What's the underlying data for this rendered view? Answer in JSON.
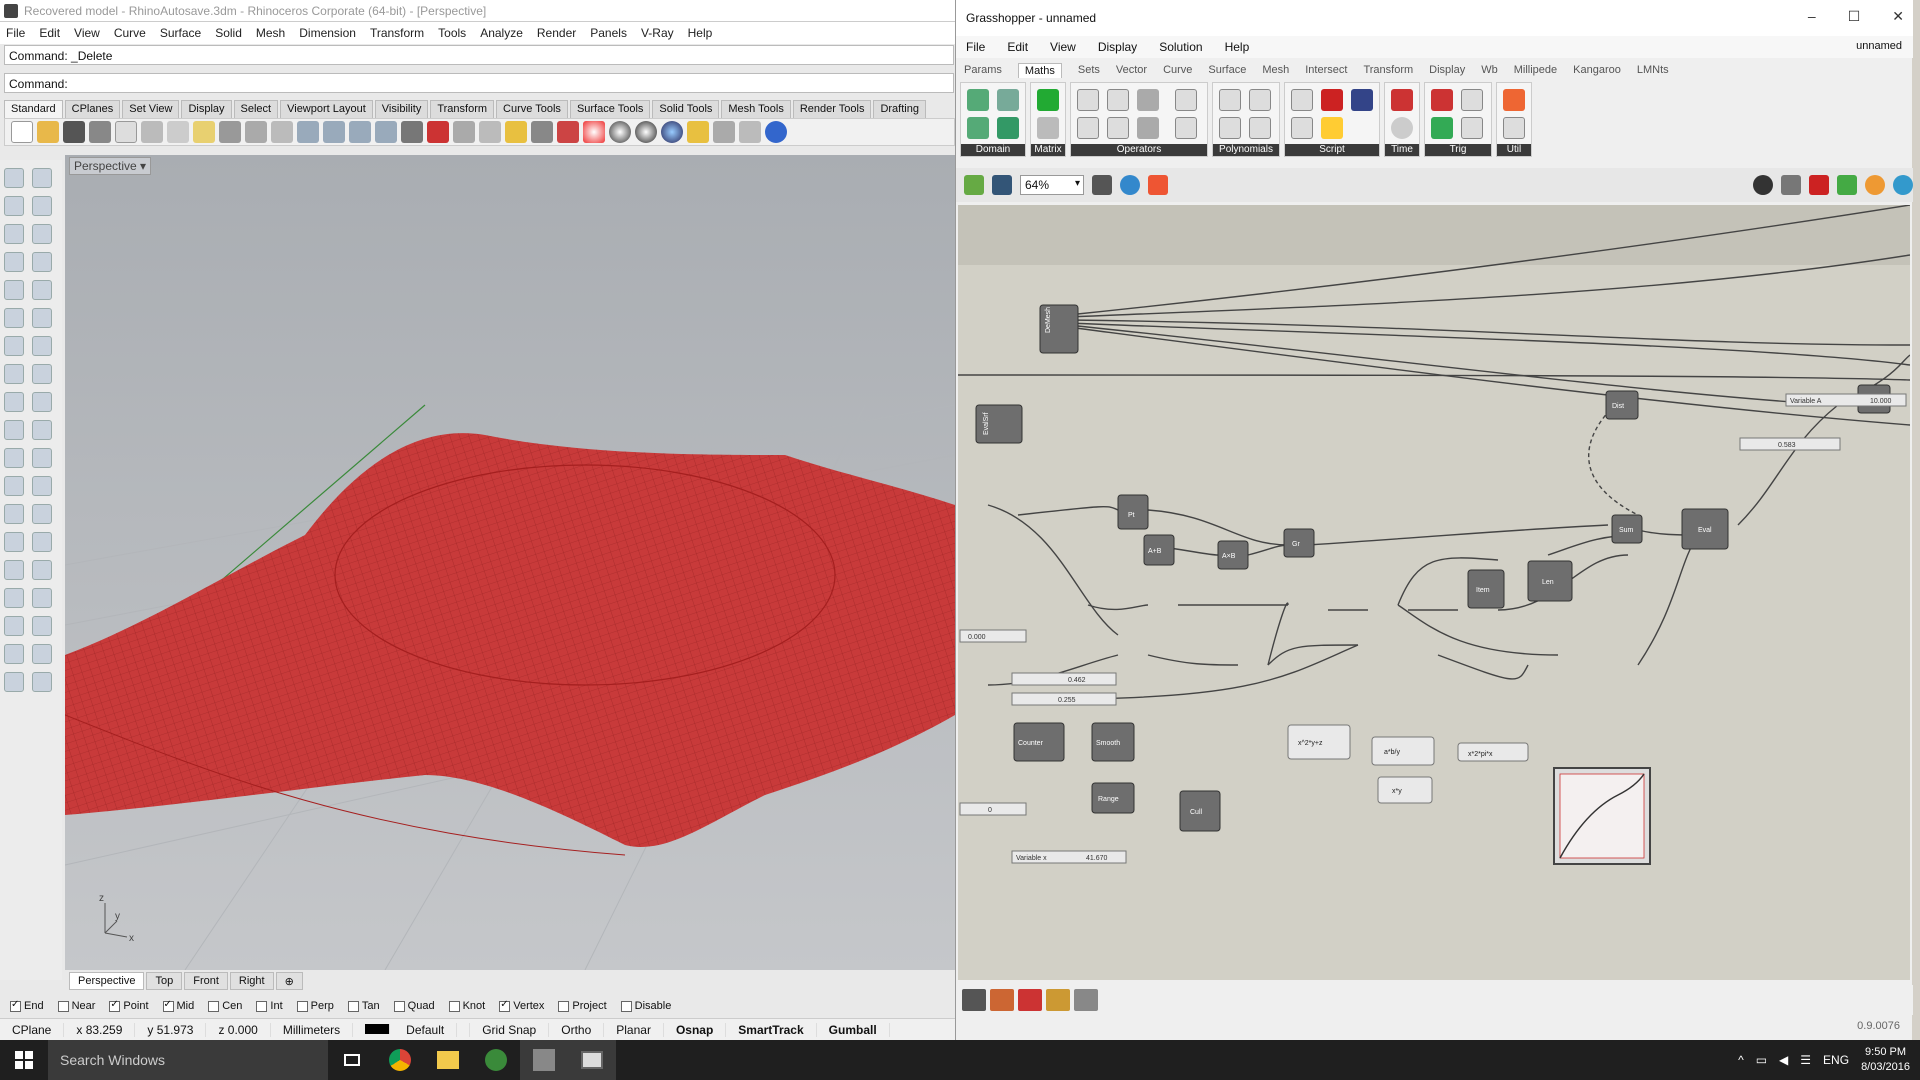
{
  "rhino": {
    "title": "Recovered model - RhinoAutosave.3dm - Rhinoceros Corporate (64-bit) - [Perspective]",
    "menu": [
      "File",
      "Edit",
      "View",
      "Curve",
      "Surface",
      "Solid",
      "Mesh",
      "Dimension",
      "Transform",
      "Tools",
      "Analyze",
      "Render",
      "Panels",
      "V-Ray",
      "Help"
    ],
    "command_history": "Command: _Delete",
    "command_prompt": "Command:",
    "toolbar_tabs": [
      "Standard",
      "CPlanes",
      "Set View",
      "Display",
      "Select",
      "Viewport Layout",
      "Visibility",
      "Transform",
      "Curve Tools",
      "Surface Tools",
      "Solid Tools",
      "Mesh Tools",
      "Render Tools",
      "Drafting"
    ],
    "viewport_label": "Perspective",
    "viewport_tabs": [
      "Perspective",
      "Top",
      "Front",
      "Right"
    ],
    "axis": {
      "z": "z",
      "y": "y",
      "x": "x"
    },
    "osnaps": [
      {
        "label": "End",
        "checked": true
      },
      {
        "label": "Near",
        "checked": false
      },
      {
        "label": "Point",
        "checked": true
      },
      {
        "label": "Mid",
        "checked": true
      },
      {
        "label": "Cen",
        "checked": false
      },
      {
        "label": "Int",
        "checked": false
      },
      {
        "label": "Perp",
        "checked": false
      },
      {
        "label": "Tan",
        "checked": false
      },
      {
        "label": "Quad",
        "checked": false
      },
      {
        "label": "Knot",
        "checked": false
      },
      {
        "label": "Vertex",
        "checked": true
      },
      {
        "label": "Project",
        "checked": false
      },
      {
        "label": "Disable",
        "checked": false
      }
    ],
    "status": {
      "cplane": "CPlane",
      "x": "x 83.259",
      "y": "y 51.973",
      "z": "z 0.000",
      "units": "Millimeters",
      "layer": "Default",
      "grid_snap": "Grid Snap",
      "ortho": "Ortho",
      "planar": "Planar",
      "osnap": "Osnap",
      "smarttrack": "SmartTrack",
      "gumball": "Gumball"
    },
    "surface_color": "#c83a3a"
  },
  "gh": {
    "title": "Grasshopper - unnamed",
    "menu": [
      "File",
      "Edit",
      "View",
      "Display",
      "Solution",
      "Help"
    ],
    "doc_name": "unnamed",
    "tabs": [
      "Params",
      "Maths",
      "Sets",
      "Vector",
      "Curve",
      "Surface",
      "Mesh",
      "Intersect",
      "Transform",
      "Display",
      "Wb",
      "Millipede",
      "Kangaroo",
      "LMNts"
    ],
    "ribbon_groups": [
      "Domain",
      "Matrix",
      "Operators",
      "Polynomials",
      "Script",
      "Time",
      "Trig",
      "Util"
    ],
    "zoom": "64%",
    "nodes": {
      "demesh": "DeMesh",
      "evalsrf": "EvalSrf",
      "pt": "Pt",
      "add": "A+B",
      "mul": "A×B",
      "dist": "Dist",
      "gr": "Gr",
      "sum": "Sum",
      "cull": "Cull",
      "range": "Range",
      "counter": "Counter",
      "smooth": "Smooth",
      "item": "Item",
      "len": "Len",
      "eval": "Eval",
      "expr1": "x^2*y+z",
      "expr2": "a*b/y",
      "expr3": "x*y",
      "expr4": "x*2*pi*x"
    },
    "sliders": {
      "s1": "Variable A",
      "s1v": "10.000",
      "s2": "0.583",
      "s3": "0.000",
      "s4": "0.462",
      "s5": "0.255",
      "s6": "0",
      "s7": "Variable x",
      "s7v": "41.670"
    },
    "version": "0.9.0076"
  },
  "taskbar": {
    "search": "Search Windows",
    "lang": "ENG",
    "time": "9:50 PM",
    "date": "8/03/2016"
  }
}
